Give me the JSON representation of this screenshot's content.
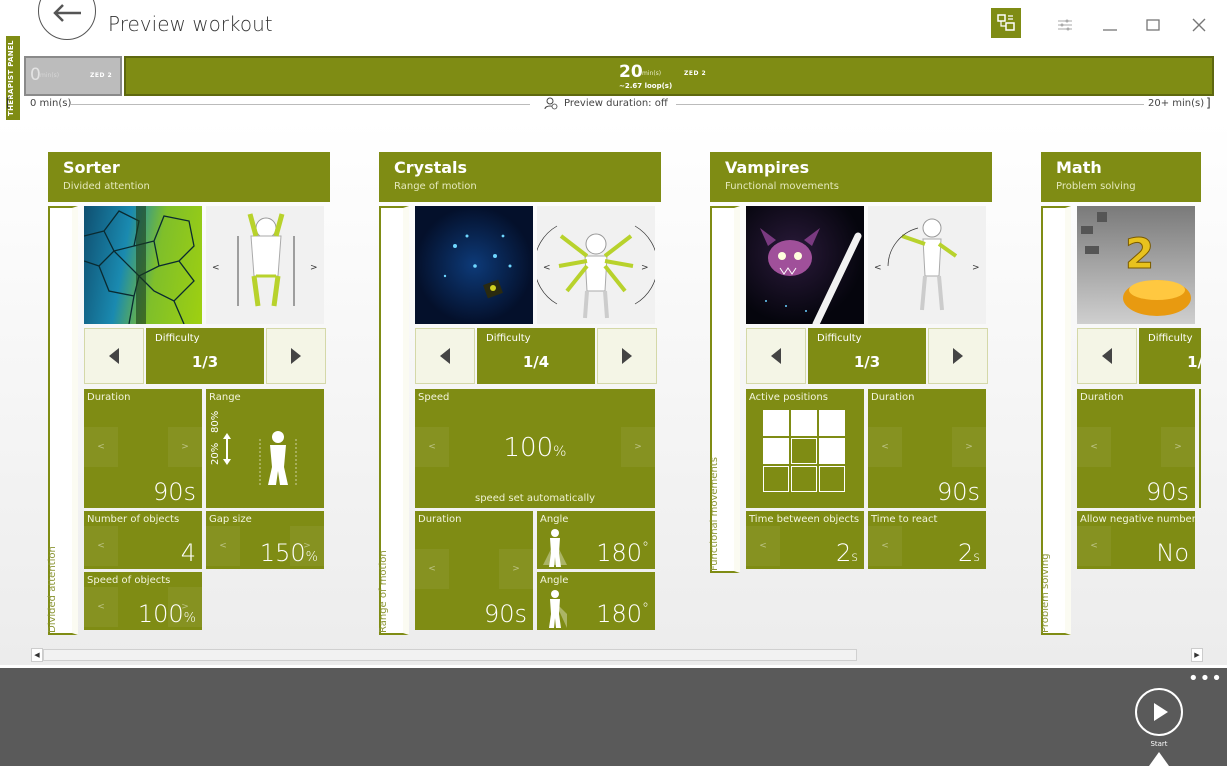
{
  "window": {
    "title": "Preview workout",
    "accent": "#7f8c14",
    "controls": [
      "therapist-panel-toggle",
      "settings-icon",
      "minimize-icon",
      "maximize-icon",
      "close-icon"
    ]
  },
  "therapist_panel_label": "THERAPIST PANEL",
  "timeline": {
    "segments": [
      {
        "value": "0",
        "unit": "min(s)",
        "tag": "ZED 2"
      },
      {
        "value": "20",
        "unit": "min(s)",
        "loops": "~2.67 loop(s)",
        "tag": "ZED 2"
      }
    ],
    "start_label": "0 min(s)",
    "end_label": "20+ min(s)",
    "preview_duration": "Preview duration: off"
  },
  "cards": [
    {
      "title": "Sorter",
      "subtitle": "Divided attention",
      "side_label": "Divided attention",
      "difficulty_label": "Difficulty",
      "difficulty_value": "1/3",
      "duration": {
        "label": "Duration",
        "value": "90s"
      },
      "range": {
        "label": "Range",
        "low": "20%",
        "high": "80%"
      },
      "objects": {
        "label": "Number of objects",
        "value": "4"
      },
      "gap": {
        "label": "Gap size",
        "value": "150",
        "unit": "%"
      },
      "speed": {
        "label": "Speed of objects",
        "value": "100",
        "unit": "%"
      }
    },
    {
      "title": "Crystals",
      "subtitle": "Range of motion",
      "side_label": "Range of motion",
      "difficulty_label": "Difficulty",
      "difficulty_value": "1/4",
      "speed": {
        "label": "Speed",
        "value": "100",
        "unit": "%",
        "note": "speed set automatically"
      },
      "duration": {
        "label": "Duration",
        "value": "90s"
      },
      "angle1": {
        "label": "Angle",
        "value": "180",
        "unit": "°"
      },
      "angle2": {
        "label": "Angle",
        "value": "180",
        "unit": "°"
      }
    },
    {
      "title": "Vampires",
      "subtitle": "Functional movements",
      "side_label": "Functional movements",
      "difficulty_label": "Difficulty",
      "difficulty_value": "1/3",
      "positions": {
        "label": "Active positions",
        "grid": [
          1,
          1,
          1,
          1,
          0,
          1,
          0,
          0,
          0
        ]
      },
      "duration": {
        "label": "Duration",
        "value": "90s"
      },
      "between": {
        "label": "Time between objects",
        "value": "2",
        "unit": "s"
      },
      "react": {
        "label": "Time to react",
        "value": "2",
        "unit": "s"
      }
    },
    {
      "title": "Math",
      "subtitle": "Problem solving",
      "side_label": "Problem solving",
      "difficulty_label": "Difficulty",
      "difficulty_value": "1/",
      "duration": {
        "label": "Duration",
        "value": "90s"
      },
      "negative": {
        "label": "Allow negative numbers",
        "value": "No"
      }
    }
  ],
  "bottom": {
    "start_label": "Start",
    "more": "•••"
  }
}
